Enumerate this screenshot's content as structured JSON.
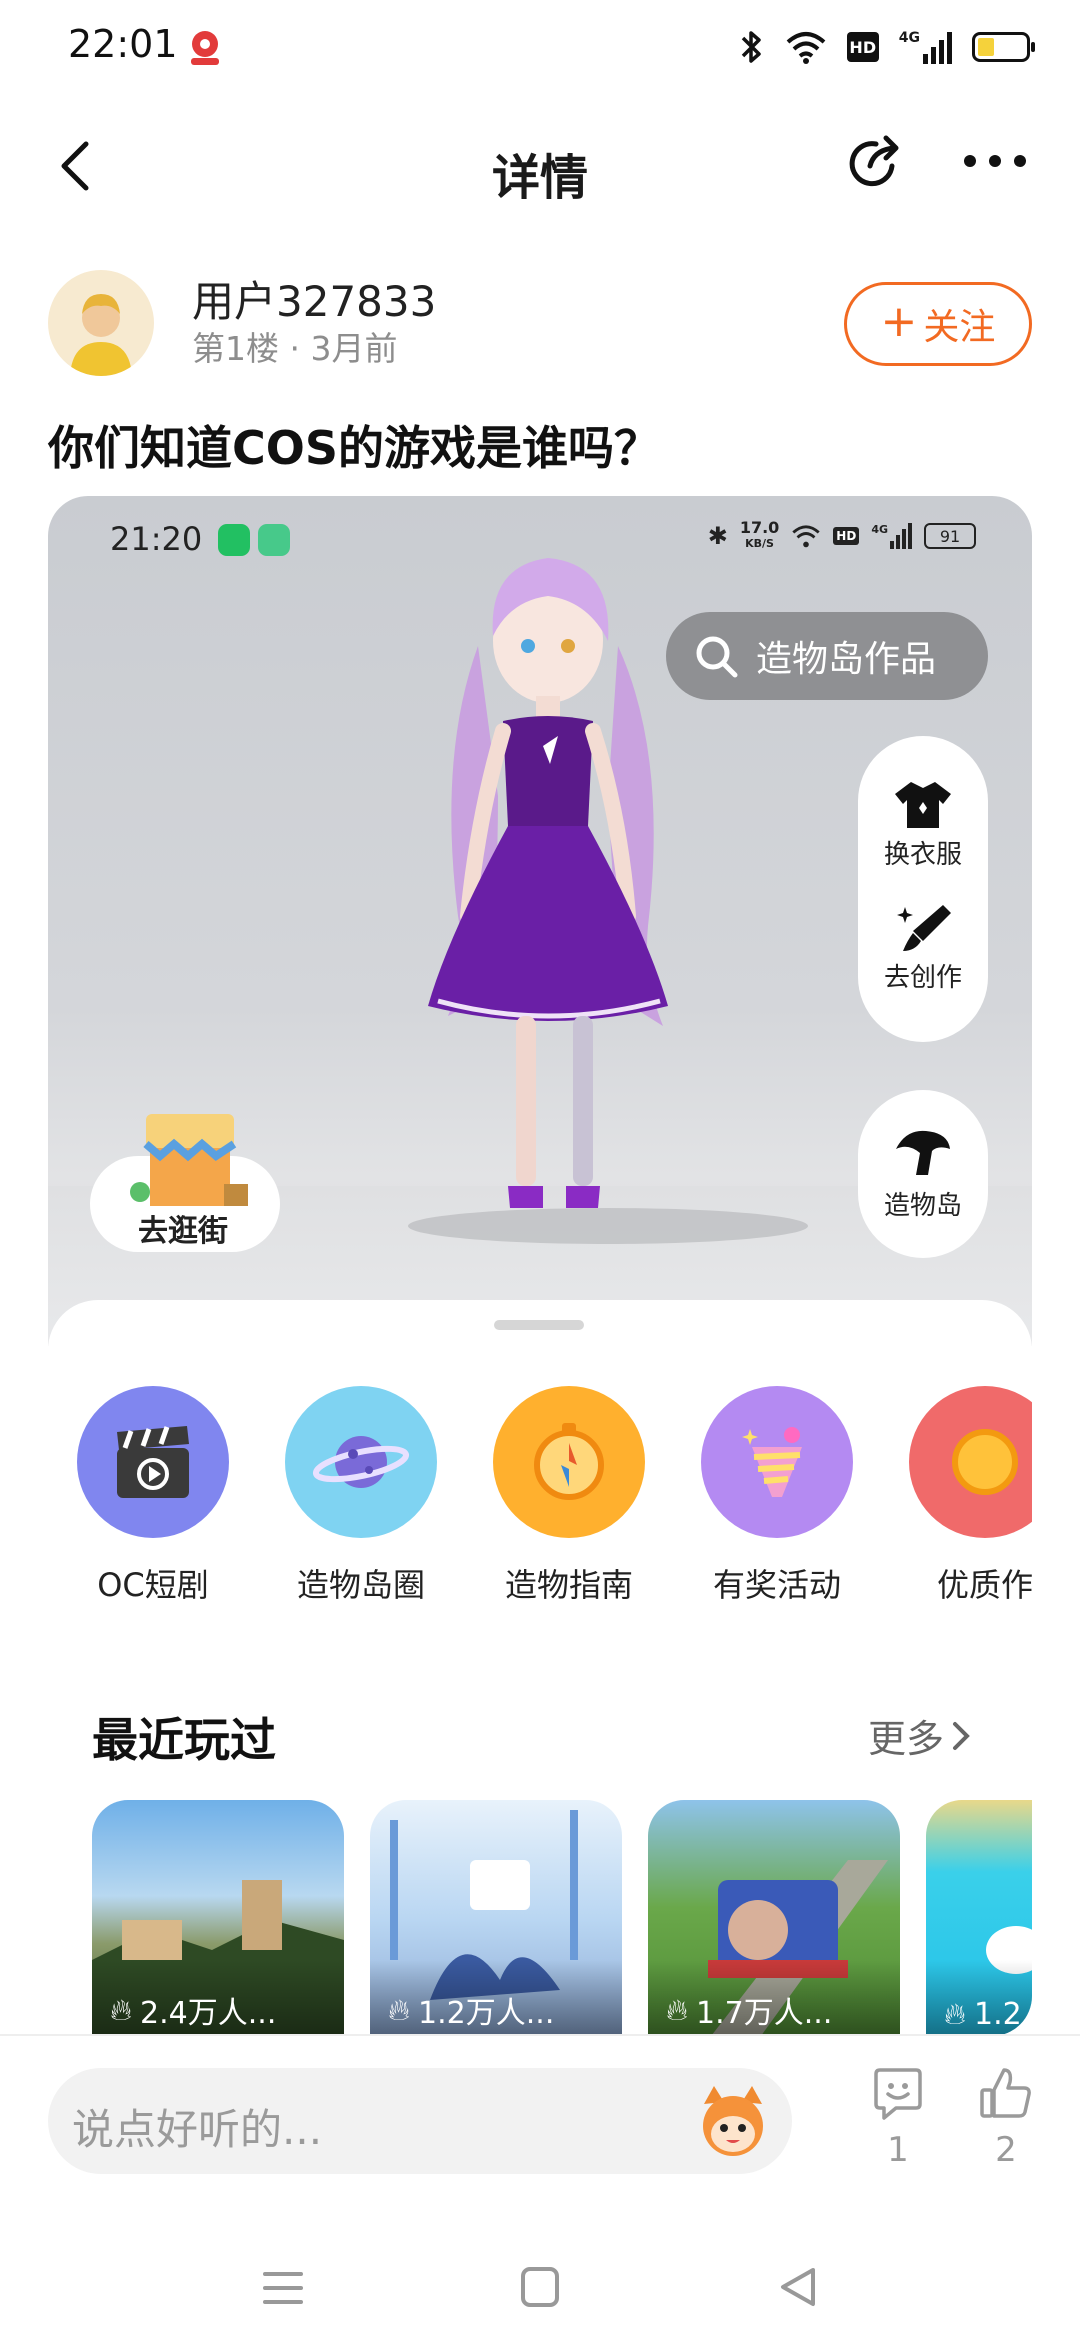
{
  "status_bar": {
    "time": "22:01",
    "network": "4G",
    "hd": "HD"
  },
  "nav": {
    "title": "详情"
  },
  "post": {
    "username": "用户327833",
    "floor": "第1楼",
    "time_ago": "3月前",
    "follow_label": "关注",
    "title": "你们知道COS的游戏是谁吗？"
  },
  "embedded": {
    "time": "21:20",
    "speed_value": "17.0",
    "speed_unit": "KB/S",
    "hd": "HD",
    "network": "4G",
    "battery": "91",
    "search_placeholder": "造物岛作品",
    "side_actions": [
      {
        "label": "换衣服"
      },
      {
        "label": "去创作"
      }
    ],
    "island_label": "造物岛",
    "shop_label": "去逛街",
    "categories": [
      {
        "label": "OC短剧",
        "color": "#8086ef"
      },
      {
        "label": "造物岛圈",
        "color": "#7fd3f2"
      },
      {
        "label": "造物指南",
        "color": "#ffb02e"
      },
      {
        "label": "有奖活动",
        "color": "#b48af2"
      },
      {
        "label": "优质作",
        "color": "#f06a6a"
      }
    ],
    "recent_title": "最近玩过",
    "more_label": "更多",
    "recent": [
      {
        "stat": "2.4万人..."
      },
      {
        "stat": "1.2万人..."
      },
      {
        "stat": "1.7万人..."
      },
      {
        "stat": "1.2"
      }
    ]
  },
  "comment_bar": {
    "placeholder": "说点好听的...",
    "comment_count": "1",
    "like_count": "2"
  },
  "colors": {
    "accent": "#f26a22"
  }
}
